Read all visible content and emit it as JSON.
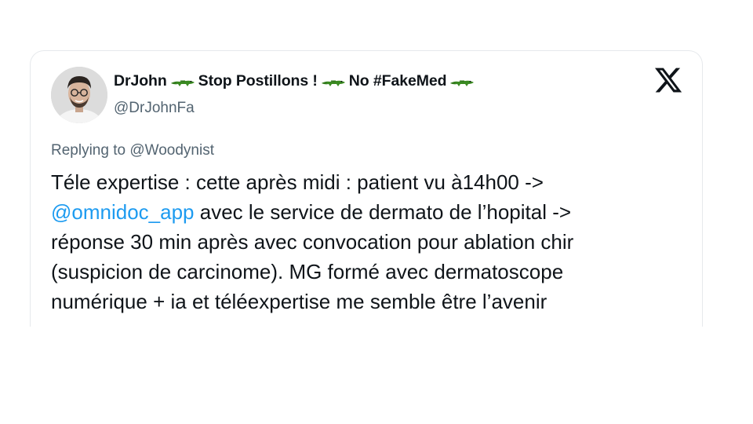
{
  "tweet": {
    "author": {
      "name_parts": [
        "DrJohn",
        "Stop Postillons !",
        "No #FakeMed"
      ],
      "handle": "@DrJohnFa",
      "avatar_icon": "profile-photo"
    },
    "reply": {
      "prefix": "Replying to",
      "to": "@Woodynist"
    },
    "body": {
      "line1": "Téle expertise : cette après midi : patient vu à14h00 ->",
      "line2_mention": "@omnidoc_app",
      "line2_rest": " avec le service de dermato de l’hopital ->",
      "line3": "réponse 30 min après avec convocation pour ablation chir",
      "line4": "(suspicion de carcinome). MG formé avec dermatoscope",
      "line5": "numérique + ia et téléexpertise me semble être l’avenir"
    },
    "platform_icon": "x-logo-icon",
    "name_emoji_icon": "crocodile-icon"
  },
  "colors": {
    "text": "#0f1419",
    "secondary": "#536471",
    "mention": "#1d9bf0",
    "border": "#e6e9ec",
    "crocodile": "#3a8a22"
  }
}
